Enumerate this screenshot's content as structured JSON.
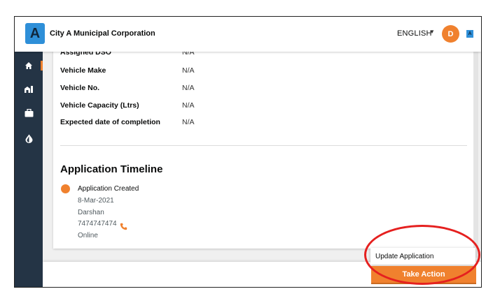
{
  "header": {
    "logo_letter": "A",
    "app_title": "City A Municipal Corporation",
    "language": "ENGLISH",
    "avatar_initial": "D",
    "mini_logo_letter": "A"
  },
  "sidebar": {
    "items": [
      {
        "icon": "home-icon",
        "active": true
      },
      {
        "icon": "city-icon",
        "active": false
      },
      {
        "icon": "briefcase-icon",
        "active": false
      },
      {
        "icon": "drop-icon",
        "active": false
      }
    ]
  },
  "details": {
    "rows": [
      {
        "label": "Assigned DSO",
        "value": "N/A"
      },
      {
        "label": "Vehicle Make",
        "value": "N/A"
      },
      {
        "label": "Vehicle No.",
        "value": "N/A"
      },
      {
        "label": "Vehicle Capacity (Ltrs)",
        "value": "N/A"
      },
      {
        "label": "Expected date of completion",
        "value": "N/A"
      }
    ]
  },
  "timeline": {
    "title": "Application Timeline",
    "event": "Application Created",
    "date": "8-Mar-2021",
    "name": "Darshan",
    "phone": "7474747474",
    "channel": "Online"
  },
  "actions": {
    "menu_item": "Update Application",
    "take_action": "Take Action"
  },
  "colors": {
    "accent": "#f0812e",
    "sidebar": "#243445",
    "brand": "#2e8fd8",
    "annotation": "#e5201f"
  }
}
